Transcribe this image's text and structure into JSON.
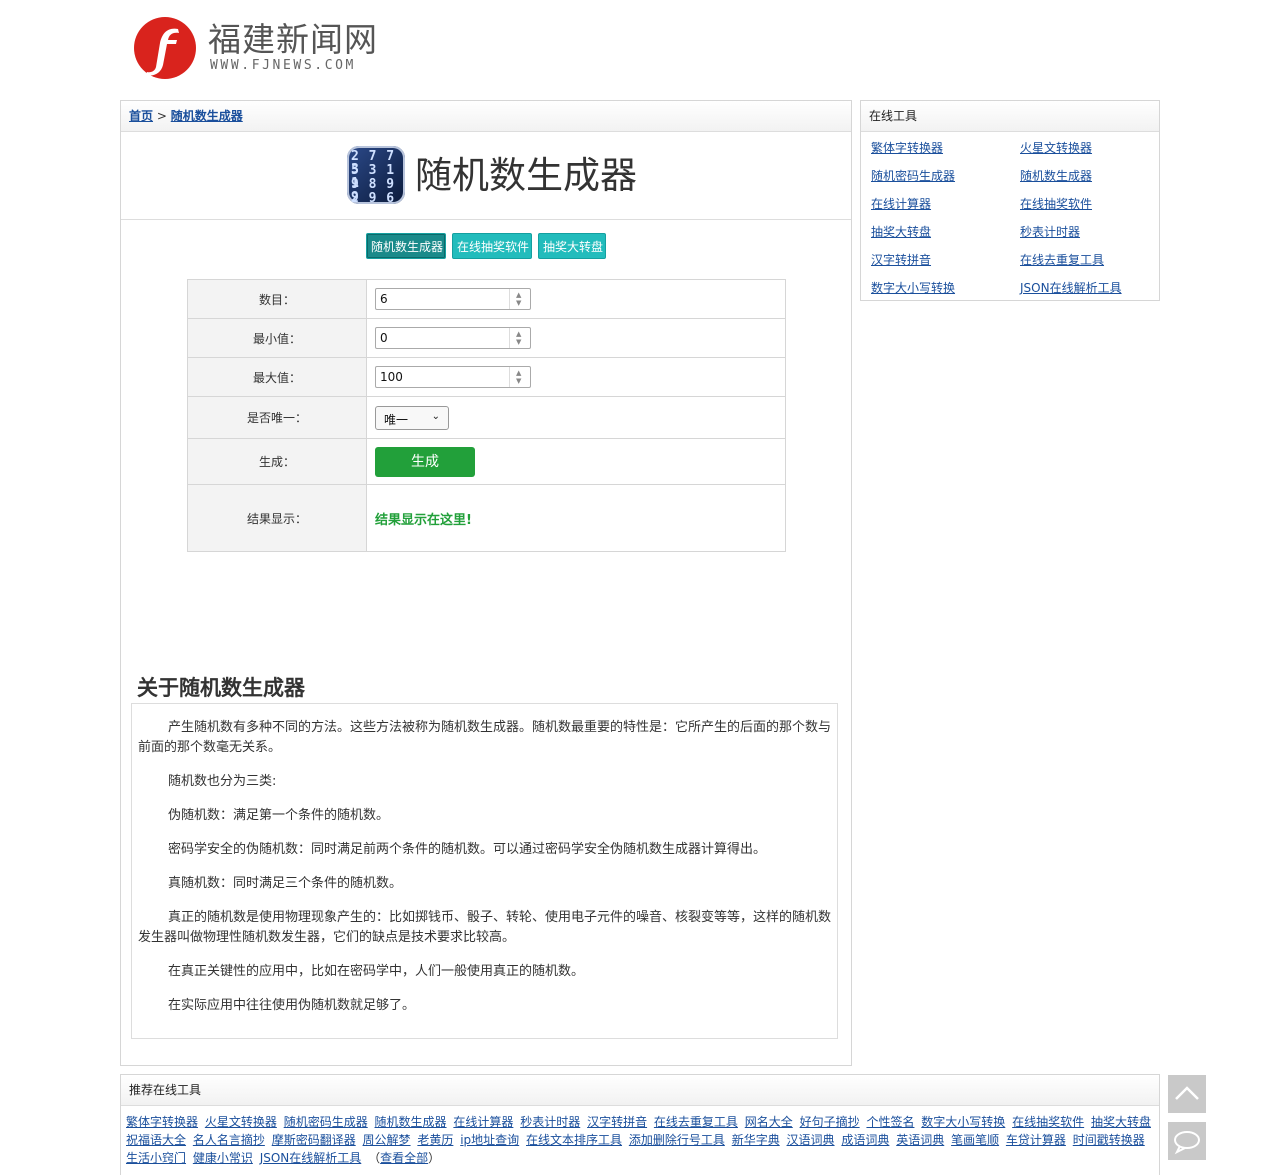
{
  "site": {
    "logo_title": "福建新闻网",
    "logo_url": "WWW.FJNEWS.COM"
  },
  "breadcrumb": {
    "home": "首页",
    "separator": ">",
    "current": "随机数生成器"
  },
  "page_title": "随机数生成器",
  "tabs": [
    "随机数生成器",
    "在线抽奖软件",
    "抽奖大转盘"
  ],
  "form": {
    "count_label": "数目：",
    "count_value": "6",
    "min_label": "最小值：",
    "min_value": "0",
    "max_label": "最大值：",
    "max_value": "100",
    "unique_label": "是否唯一：",
    "unique_selected": "唯一",
    "generate_label": "生成：",
    "generate_button": "生成",
    "result_label": "结果显示：",
    "result_text": "结果显示在这里!"
  },
  "about": {
    "heading": "关于随机数生成器",
    "paragraphs": [
      "产生随机数有多种不同的方法。这些方法被称为随机数生成器。随机数最重要的特性是：它所产生的后面的那个数与前面的那个数毫无关系。",
      "随机数也分为三类:",
      "伪随机数：满足第一个条件的随机数。",
      "密码学安全的伪随机数：同时满足前两个条件的随机数。可以通过密码学安全伪随机数生成器计算得出。",
      "真随机数：同时满足三个条件的随机数。",
      "真正的随机数是使用物理现象产生的：比如掷钱币、骰子、转轮、使用电子元件的噪音、核裂变等等，这样的随机数发生器叫做物理性随机数发生器，它们的缺点是技术要求比较高。",
      "在真正关键性的应用中，比如在密码学中，人们一般使用真正的随机数。",
      "在实际应用中往往使用伪随机数就足够了。"
    ]
  },
  "sidebar": {
    "title": "在线工具",
    "links": [
      "繁体字转换器",
      "火星文转换器",
      "随机密码生成器",
      "随机数生成器",
      "在线计算器",
      "在线抽奖软件",
      "抽奖大转盘",
      "秒表计时器",
      "汉字转拼音",
      "在线去重复工具",
      "数字大小写转换",
      "JSON在线解析工具"
    ]
  },
  "recommend": {
    "title": "推荐在线工具",
    "links": [
      "繁体字转换器",
      "火星文转换器",
      "随机密码生成器",
      "随机数生成器",
      "在线计算器",
      "秒表计时器",
      "汉字转拼音",
      "在线去重复工具",
      "网名大全",
      "好句子摘抄",
      "个性签名",
      "数字大小写转换",
      "在线抽奖软件",
      "抽奖大转盘",
      "祝福语大全",
      "名人名言摘抄",
      "摩斯密码翻译器",
      "周公解梦",
      "老黄历",
      "ip地址查询",
      "在线文本排序工具",
      "添加删除行号工具",
      "新华字典",
      "汉语词典",
      "成语词典",
      "英语词典",
      "笔画笔顺",
      "车贷计算器",
      "时间戳转换器",
      "生活小窍门",
      "健康小常识",
      "JSON在线解析工具"
    ],
    "view_all": "查看全部"
  },
  "icons": {
    "back_to_top": "chevron-up-icon",
    "feedback": "chat-bubble-icon"
  },
  "colors": {
    "accent_teal": "#22bcbc",
    "button_green": "#22a03a",
    "logo_red": "#d9231d",
    "link_blue": "#1a4f9c"
  }
}
